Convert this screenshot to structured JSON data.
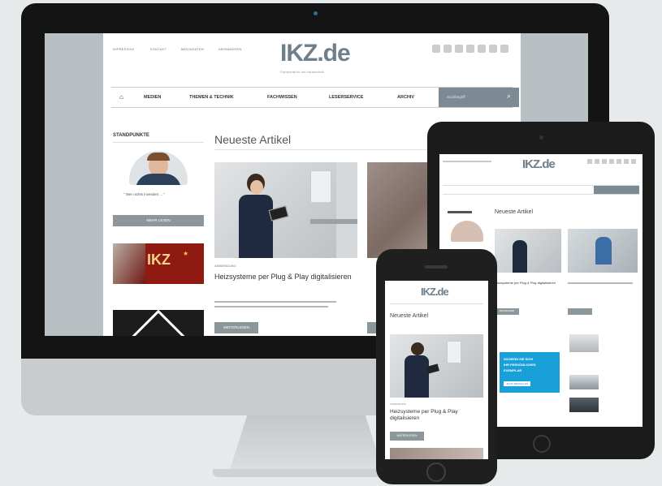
{
  "desktop": {
    "top_links": [
      "IMPRESSUM",
      "KONTAKT",
      "MEDIADATEN",
      "ABONNIEREN"
    ],
    "logo": "IKZ.de",
    "logo_tagline": "Fachportal für die Haustechnik",
    "main_nav": [
      "MEDIEN",
      "THEMEN & TECHNIK",
      "FACHWISSEN",
      "LESERSERVICE",
      "ARCHIV"
    ],
    "search_placeholder": "Suchbegriff",
    "sidebar": {
      "title": "STANDPUNKTE",
      "quote": "\" Wer nichts investiert ... \"",
      "button": "MEHR LESEN",
      "banner_logo": "IKZ"
    },
    "section_title": "Neueste Artikel",
    "article": {
      "tag": "ANWENDUNG",
      "title": "Heizsysteme per Plug & Play digitalisieren",
      "button": "WEITERLESEN"
    }
  },
  "tablet": {
    "logo": "IKZ.de",
    "section_title": "Neueste Artikel",
    "article1_title": "Heizsysteme per Plug & Play digitalisieren",
    "button": "WEITERLESEN",
    "promo_line1": "SICHERN SIE SICH",
    "promo_line2": "IHR PERSÖNLICHES",
    "promo_line3": "EXEMPLAR",
    "promo_button": "JETZT BESTELLEN"
  },
  "phone": {
    "logo": "IKZ.de",
    "section_title": "Neueste Artikel",
    "tag": "ANWENDUNG",
    "article_title": "Heizsysteme per Plug & Play digitalisieren",
    "button": "WEITERLESEN"
  },
  "colors": {
    "accent": "#7c8b93",
    "logo": "#6f7f8a",
    "promo": "#1aa0d8",
    "banner": "#8e1a12"
  }
}
